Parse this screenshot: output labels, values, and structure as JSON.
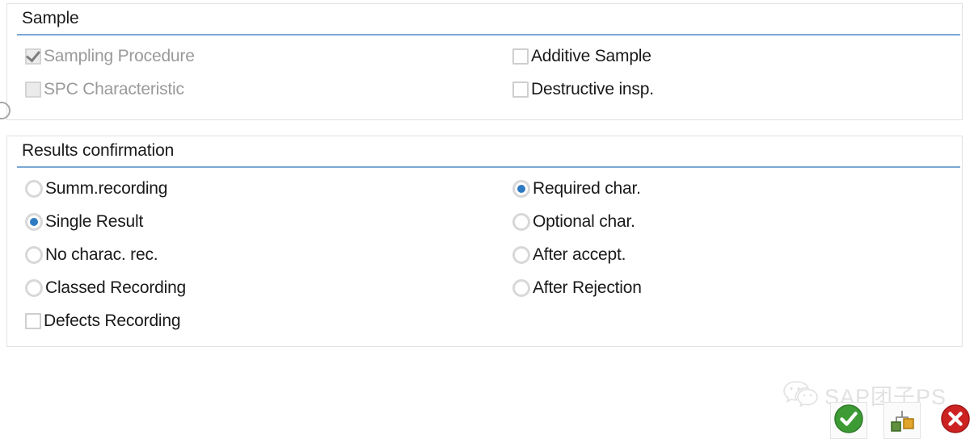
{
  "panels": [
    {
      "id": "sample",
      "title": "Sample",
      "left_options": [
        {
          "control": "checkbox",
          "label": "Sampling Procedure",
          "checked": true,
          "disabled": true
        },
        {
          "control": "checkbox",
          "label": "SPC Characteristic",
          "checked": false,
          "disabled": true
        }
      ],
      "right_options": [
        {
          "control": "checkbox",
          "label": "Additive Sample",
          "checked": false,
          "disabled": false
        },
        {
          "control": "checkbox",
          "label": "Destructive insp.",
          "checked": false,
          "disabled": false
        }
      ]
    },
    {
      "id": "results",
      "title": "Results confirmation",
      "left_options": [
        {
          "control": "radio",
          "label": "Summ.recording",
          "checked": false,
          "disabled": false
        },
        {
          "control": "radio",
          "label": "Single Result",
          "checked": true,
          "disabled": false
        },
        {
          "control": "radio",
          "label": "No charac. rec.",
          "checked": false,
          "disabled": false
        },
        {
          "control": "radio",
          "label": "Classed Recording",
          "checked": false,
          "disabled": false
        },
        {
          "control": "checkbox",
          "label": "Defects Recording",
          "checked": false,
          "disabled": false
        }
      ],
      "right_options": [
        {
          "control": "radio",
          "label": "Required char.",
          "checked": true,
          "disabled": false
        },
        {
          "control": "radio",
          "label": "Optional char.",
          "checked": false,
          "disabled": false
        },
        {
          "control": "radio",
          "label": "After accept.",
          "checked": false,
          "disabled": false
        },
        {
          "control": "radio",
          "label": "After Rejection",
          "checked": false,
          "disabled": false
        }
      ]
    }
  ],
  "toolbar": {
    "continue_button": {
      "icon": "green-check-circle-icon",
      "label": ""
    },
    "hierarchy_button": {
      "icon": "hierarchy-tree-icon",
      "label": ""
    },
    "cancel_button": {
      "icon": "red-x-circle-icon",
      "label": ""
    }
  },
  "watermark": {
    "logo": "wechat-icon",
    "text": "SAP团子PS"
  },
  "colors": {
    "rule_blue": "#7ba7d7",
    "radio_selected": "#2e7bc4",
    "disabled_text": "#9a9a9a",
    "text": "#1a1a1a",
    "check_green": "#3d9b35",
    "cancel_red": "#cc2222",
    "node_green": "#5f8f3f",
    "node_orange": "#e2a52b"
  }
}
